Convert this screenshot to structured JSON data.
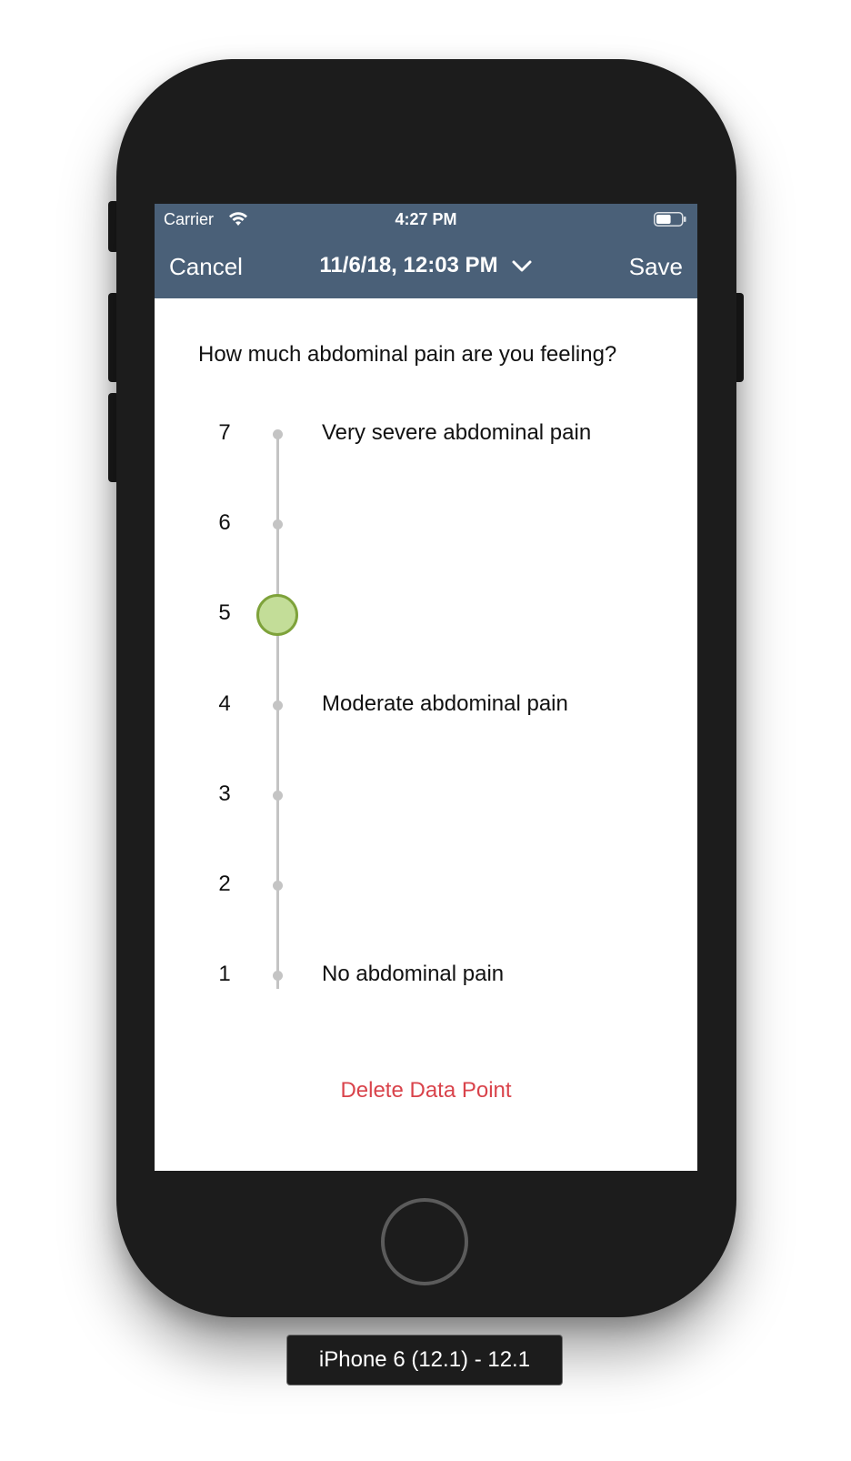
{
  "device": {
    "label": "iPhone 6 (12.1) - 12.1"
  },
  "status_bar": {
    "carrier": "Carrier",
    "time": "4:27 PM",
    "battery_level": 0.6
  },
  "nav": {
    "cancel_label": "Cancel",
    "date": "11/6/18, 12:03 PM",
    "save_label": "Save"
  },
  "question": "How much abdominal pain are you feeling?",
  "scale": {
    "selected": 5,
    "rows": [
      {
        "value": "7",
        "label": "Very severe abdominal pain"
      },
      {
        "value": "6",
        "label": ""
      },
      {
        "value": "5",
        "label": ""
      },
      {
        "value": "4",
        "label": "Moderate abdominal pain"
      },
      {
        "value": "3",
        "label": ""
      },
      {
        "value": "2",
        "label": ""
      },
      {
        "value": "1",
        "label": "No abdominal pain"
      }
    ]
  },
  "delete_label": "Delete Data Point",
  "colors": {
    "nav_background": "#4a6078",
    "thumb_fill": "#c3dd98",
    "thumb_border": "#7ea23a",
    "destructive": "#d9434b"
  },
  "icons": {
    "wifi": "wifi-icon",
    "battery": "battery-icon",
    "chevron": "chevron-down-icon"
  }
}
